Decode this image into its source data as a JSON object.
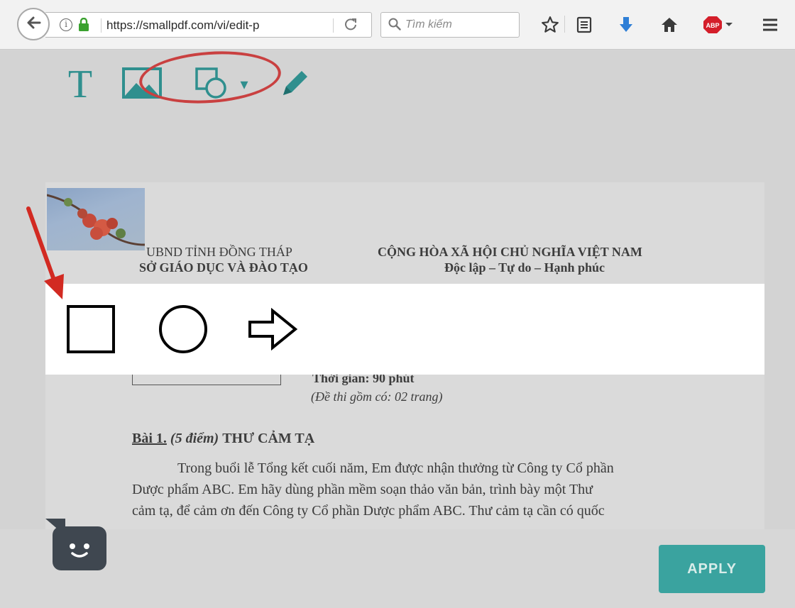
{
  "browser": {
    "url": "https://smallpdf.com/vi/edit-p",
    "search_placeholder": "Tìm kiếm",
    "adblock_label": "ABP"
  },
  "toolbar": {
    "text_tool_glyph": "T",
    "shape_dropdown_glyph": "▾"
  },
  "document": {
    "left_header": [
      "UBND TỈNH ĐỒNG THÁP",
      "SỞ GIÁO DỤC VÀ ĐÀO TẠO"
    ],
    "right_header": [
      "CỘNG HÒA XÃ HỘI CHỦ NGHĨA VIỆT NAM",
      "Độc lập – Tự do – Hạnh phúc"
    ],
    "time_label": "Thời gian: 90 phút",
    "pages_note": "(Đề thi gồm có: 02 trang)",
    "question_label": "Bài 1.",
    "question_points": "(5 điểm)",
    "question_title": "THƯ CẢM TẠ",
    "paragraph_lines": [
      "Trong buổi lễ Tổng kết cuối năm, Em được nhận thưởng từ Công ty Cổ phần",
      "Dược phẩm ABC. Em hãy dùng phần mềm soạn thảo văn bản, trình bày một Thư",
      "cảm tạ, để cảm ơn đến Công ty Cổ phần Dược phẩm ABC. Thư cảm tạ cần có quốc"
    ]
  },
  "shape_menu": {
    "items": [
      {
        "name": "rectangle",
        "icon": "square-outline-icon"
      },
      {
        "name": "circle",
        "icon": "circle-outline-icon"
      },
      {
        "name": "arrow",
        "icon": "arrow-outline-icon"
      }
    ]
  },
  "actions": {
    "apply_label": "APPLY"
  },
  "colors": {
    "accent": "#3aa39f",
    "highlight_ring": "#c94040",
    "annotation_arrow": "#d22a22"
  }
}
